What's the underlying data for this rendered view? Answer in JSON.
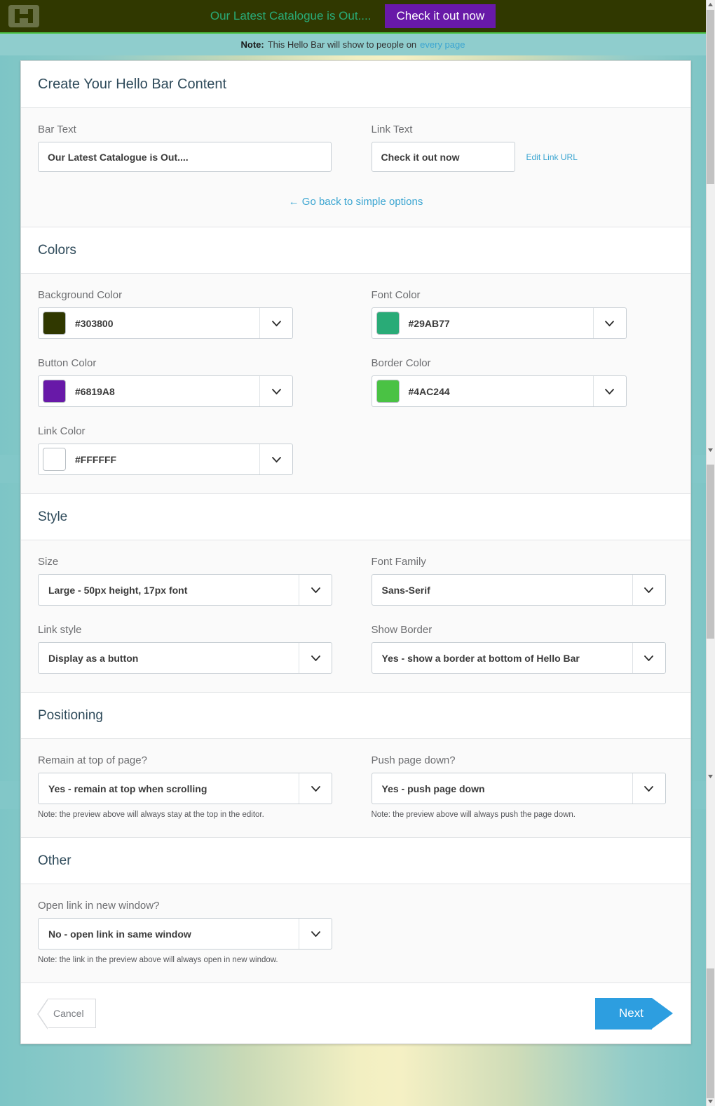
{
  "preview": {
    "logo_icon": "hellobar-h-logo-icon",
    "bar_text": "Our Latest Catalogue is Out....",
    "button_label": "Check it out now",
    "background_color": "#303800",
    "font_color": "#29AB77",
    "button_color": "#6819A8",
    "border_color": "#4AC244",
    "link_color": "#FFFFFF"
  },
  "note_strip": {
    "prefix": "Note:",
    "text": "This Hello Bar will show to people on",
    "link": "every page"
  },
  "modal": {
    "content_section": {
      "title": "Create Your Hello Bar Content",
      "bar_text_label": "Bar Text",
      "bar_text_value": "Our Latest Catalogue is Out....",
      "link_text_label": "Link Text",
      "link_text_value": "Check it out now",
      "edit_link_url_label": "Edit Link URL",
      "simple_options_link": "← Go back to simple options"
    },
    "colors_section": {
      "title": "Colors",
      "fields": [
        {
          "label": "Background Color",
          "value": "#303800",
          "swatch": "#303800"
        },
        {
          "label": "Font Color",
          "value": "#29AB77",
          "swatch": "#29AB77"
        },
        {
          "label": "Button Color",
          "value": "#6819A8",
          "swatch": "#6819A8"
        },
        {
          "label": "Border Color",
          "value": "#4AC244",
          "swatch": "#4AC244"
        },
        {
          "label": "Link Color",
          "value": "#FFFFFF",
          "swatch": "#FFFFFF"
        }
      ]
    },
    "style_section": {
      "title": "Style",
      "size_label": "Size",
      "size_value": "Large - 50px height, 17px font",
      "font_family_label": "Font Family",
      "font_family_value": "Sans-Serif",
      "link_style_label": "Link style",
      "link_style_value": "Display as a button",
      "show_border_label": "Show Border",
      "show_border_value": "Yes - show a border at bottom of Hello Bar"
    },
    "positioning_section": {
      "title": "Positioning",
      "remain_top_label": "Remain at top of page?",
      "remain_top_value": "Yes - remain at top when scrolling",
      "remain_top_note": "Note: the preview above will always stay at the top in the editor.",
      "push_down_label": "Push page down?",
      "push_down_value": "Yes - push page down",
      "push_down_note": "Note: the preview above will always push the page down."
    },
    "other_section": {
      "title": "Other",
      "open_new_window_label": "Open link in new window?",
      "open_new_window_value": "No - open link in same window",
      "open_new_window_note": "Note: the link in the preview above will always open in new window."
    },
    "footer": {
      "cancel_label": "Cancel",
      "next_label": "Next"
    }
  }
}
